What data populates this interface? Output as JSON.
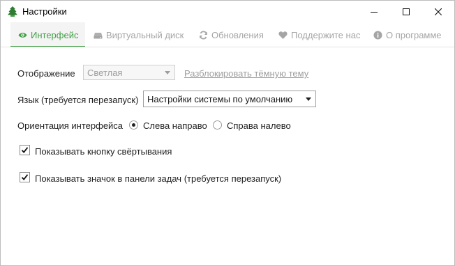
{
  "window": {
    "title": "Настройки",
    "accent_color": "#43a047",
    "controls": [
      "minimize-icon",
      "maximize-icon",
      "close-icon"
    ]
  },
  "tabs": [
    {
      "label": "Интерфейс",
      "icon": "eye-icon",
      "active": true
    },
    {
      "label": "Виртуальный диск",
      "icon": "drive-icon",
      "active": false
    },
    {
      "label": "Обновления",
      "icon": "refresh-icon",
      "active": false
    },
    {
      "label": "Поддержите нас",
      "icon": "heart-icon",
      "active": false
    },
    {
      "label": "О программе",
      "icon": "info-icon",
      "active": false
    }
  ],
  "settings": {
    "display": {
      "label": "Отображение",
      "value": "Светлая",
      "enabled": false,
      "unlock_link": "Разблокировать тёмную тему"
    },
    "language": {
      "label": "Язык (требуется перезапуск)",
      "value": "Настройки системы по умолчанию"
    },
    "orientation": {
      "label": "Ориентация интерфейса",
      "options": [
        {
          "label": "Слева направо",
          "checked": true
        },
        {
          "label": "Справа налево",
          "checked": false
        }
      ]
    },
    "show_minimize_button": {
      "label": "Показывать кнопку свёртывания",
      "checked": true
    },
    "show_taskbar_icon": {
      "label": "Показывать значок в панели задач (требуется перезапуск)",
      "checked": true
    }
  }
}
